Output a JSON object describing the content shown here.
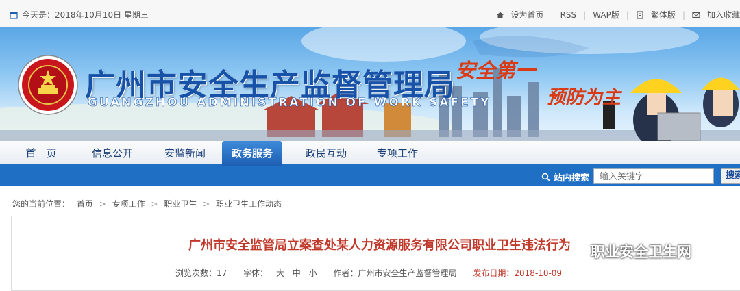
{
  "topbar": {
    "date_text": "今天是：2018年10月10日 星期三",
    "links": [
      "设为首页",
      "RSS",
      "WAP版",
      "繁体版",
      "加入收藏"
    ]
  },
  "banner": {
    "title_cn": "广州市安全生产监督管理局",
    "title_en": "GUANGZHOU ADMINISTRATION OF WORK SAFETY",
    "slogan_1": "安全第一",
    "slogan_2": "预防为主"
  },
  "nav": {
    "items": [
      "首　页",
      "信息公开",
      "安监新闻",
      "政务服务",
      "政民互动",
      "专项工作"
    ],
    "active_index": 3
  },
  "search": {
    "label": "站内搜索",
    "placeholder": "输入关键字",
    "button": "搜索"
  },
  "breadcrumb": {
    "prefix": "您的当前位置：",
    "items": [
      "首页",
      "专项工作",
      "职业卫生",
      "职业卫生工作动态"
    ]
  },
  "article": {
    "title": "广州市安全监管局立案查处某人力资源服务有限公司职业卫生违法行为",
    "views_label": "浏览次数：17",
    "font_label": "字体：",
    "font_sizes": [
      "大",
      "中",
      "小"
    ],
    "author": "作者：广州市安全生产监督管理局",
    "publish_date": "发布日期：2018-10-09"
  },
  "watermark": {
    "text": "职业安全卫生网"
  },
  "colors": {
    "nav_blue": "#1f6fc4",
    "title_blue": "#1752a8",
    "slogan_red": "#d93a14",
    "headline_red": "#c0392b"
  }
}
